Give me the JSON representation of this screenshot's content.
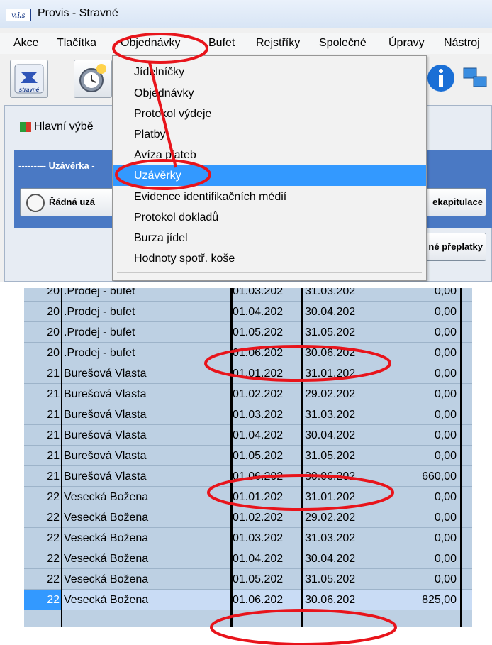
{
  "window": {
    "app_icon_text": "v.i.s",
    "title": "Provis - Stravné"
  },
  "menubar": {
    "items": [
      "Akce",
      "Tlačítka",
      "Objednávky",
      "Bufet",
      "Rejstříky",
      "Společné",
      "Úpravy",
      "Nástroj"
    ]
  },
  "toolbar": {
    "stravne_label": "stravné"
  },
  "main": {
    "tab_label": "Hlavní výbě",
    "close_group_label": "--------- Uzávěrka -",
    "btn_regular_close": "Řádná uzá",
    "btn_recap": "ekapitulace",
    "btn_overpay": "né přeplatky"
  },
  "dropdown": {
    "items": [
      {
        "label": "Jídelníčky",
        "selected": false
      },
      {
        "label": "Objednávky",
        "selected": false
      },
      {
        "label": "Protokol výdeje",
        "selected": false
      },
      {
        "label": "Platby",
        "selected": false
      },
      {
        "label": "Avíza plateb",
        "selected": false
      },
      {
        "label": "Uzávěrky",
        "selected": true
      },
      {
        "label": "Evidence identifikačních médií",
        "selected": false
      },
      {
        "label": "Protokol dokladů",
        "selected": false
      },
      {
        "label": "Burza jídel",
        "selected": false
      },
      {
        "label": "Hodnoty spotř. koše",
        "selected": false
      }
    ]
  },
  "table": {
    "rows": [
      {
        "id": "20",
        "name": ".Prodej - bufet",
        "from": "01.03.202",
        "to": "31.03.202",
        "amount": "0,00",
        "selected": false
      },
      {
        "id": "20",
        "name": ".Prodej - bufet",
        "from": "01.04.202",
        "to": "30.04.202",
        "amount": "0,00",
        "selected": false
      },
      {
        "id": "20",
        "name": ".Prodej - bufet",
        "from": "01.05.202",
        "to": "31.05.202",
        "amount": "0,00",
        "selected": false
      },
      {
        "id": "20",
        "name": ".Prodej - bufet",
        "from": "01.06.202",
        "to": "30.06.202",
        "amount": "0,00",
        "selected": false
      },
      {
        "id": "21",
        "name": "Burešová Vlasta",
        "from": "01.01.202",
        "to": "31.01.202",
        "amount": "0,00",
        "selected": false
      },
      {
        "id": "21",
        "name": "Burešová Vlasta",
        "from": "01.02.202",
        "to": "29.02.202",
        "amount": "0,00",
        "selected": false
      },
      {
        "id": "21",
        "name": "Burešová Vlasta",
        "from": "01.03.202",
        "to": "31.03.202",
        "amount": "0,00",
        "selected": false
      },
      {
        "id": "21",
        "name": "Burešová Vlasta",
        "from": "01.04.202",
        "to": "30.04.202",
        "amount": "0,00",
        "selected": false
      },
      {
        "id": "21",
        "name": "Burešová Vlasta",
        "from": "01.05.202",
        "to": "31.05.202",
        "amount": "0,00",
        "selected": false
      },
      {
        "id": "21",
        "name": "Burešová Vlasta",
        "from": "01.06.202",
        "to": "30.06.202",
        "amount": "660,00",
        "selected": false
      },
      {
        "id": "22",
        "name": "Vesecká Božena",
        "from": "01.01.202",
        "to": "31.01.202",
        "amount": "0,00",
        "selected": false
      },
      {
        "id": "22",
        "name": "Vesecká Božena",
        "from": "01.02.202",
        "to": "29.02.202",
        "amount": "0,00",
        "selected": false
      },
      {
        "id": "22",
        "name": "Vesecká Božena",
        "from": "01.03.202",
        "to": "31.03.202",
        "amount": "0,00",
        "selected": false
      },
      {
        "id": "22",
        "name": "Vesecká Božena",
        "from": "01.04.202",
        "to": "30.04.202",
        "amount": "0,00",
        "selected": false
      },
      {
        "id": "22",
        "name": "Vesecká Božena",
        "from": "01.05.202",
        "to": "31.05.202",
        "amount": "0,00",
        "selected": false
      },
      {
        "id": "22",
        "name": "Vesecká Božena",
        "from": "01.06.202",
        "to": "30.06.202",
        "amount": "825,00",
        "selected": true
      }
    ]
  },
  "annotation_color": "#e8141b",
  "selection_color": "#3399ff"
}
